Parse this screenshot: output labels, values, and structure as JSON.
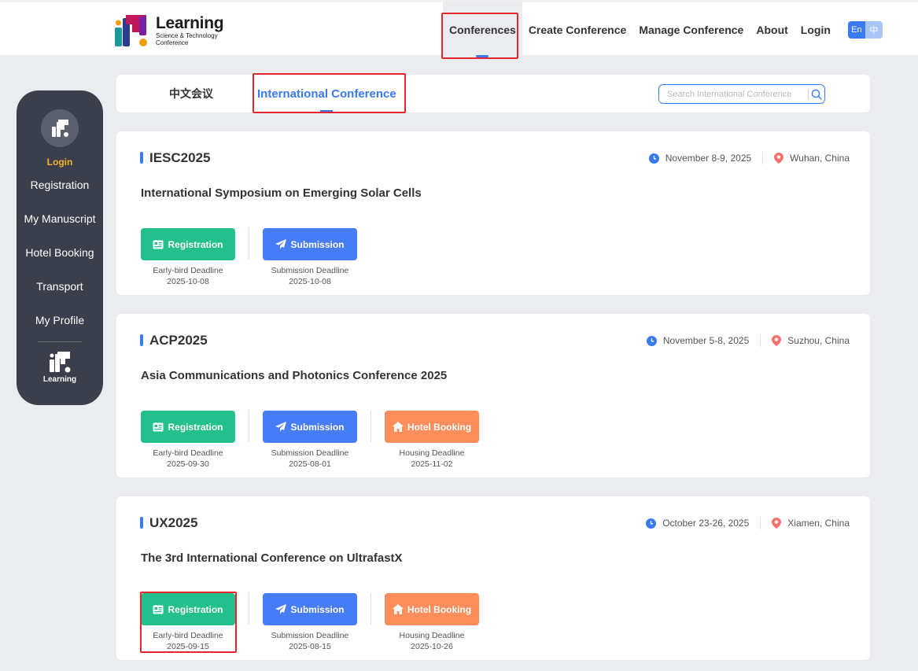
{
  "header": {
    "logo_title": "Learning",
    "logo_sub1": "Science & Technology",
    "logo_sub2": "Conference",
    "nav": [
      {
        "label": "Conferences"
      },
      {
        "label": "Create Conference"
      },
      {
        "label": "Manage Conference"
      },
      {
        "label": "About"
      },
      {
        "label": "Login"
      }
    ],
    "lang_en": "En",
    "lang_zh": "中"
  },
  "sidebar": {
    "login": "Login",
    "items": [
      {
        "label": "Registration"
      },
      {
        "label": "My Manuscript"
      },
      {
        "label": "Hotel Booking"
      },
      {
        "label": "Transport"
      },
      {
        "label": "My Profile"
      }
    ],
    "logo_text": "Learning"
  },
  "tabs": {
    "cn": "中文会议",
    "intl": "International Conference",
    "search_placeholder": "Search International Conference"
  },
  "conferences": [
    {
      "code": "IESC2025",
      "date": "November 8-9, 2025",
      "location": "Wuhan, China",
      "title": "International Symposium on Emerging Solar Cells",
      "actions": [
        {
          "label": "Registration",
          "deadline_label": "Early-bird Deadline",
          "deadline": "2025-10-08"
        },
        {
          "label": "Submission",
          "deadline_label": "Submission Deadline",
          "deadline": "2025-10-08"
        }
      ]
    },
    {
      "code": "ACP2025",
      "date": "November 5-8, 2025",
      "location": "Suzhou, China",
      "title": "Asia Communications and Photonics Conference 2025",
      "actions": [
        {
          "label": "Registration",
          "deadline_label": "Early-bird Deadline",
          "deadline": "2025-09-30"
        },
        {
          "label": "Submission",
          "deadline_label": "Submission Deadline",
          "deadline": "2025-08-01"
        },
        {
          "label": "Hotel Booking",
          "deadline_label": "Housing Deadline",
          "deadline": "2025-11-02"
        }
      ]
    },
    {
      "code": "UX2025",
      "date": "October 23-26, 2025",
      "location": "Xiamen, China",
      "title": "The 3rd International Conference on UltrafastX",
      "actions": [
        {
          "label": "Registration",
          "deadline_label": "Early-bird Deadline",
          "deadline": "2025-09-15"
        },
        {
          "label": "Submission",
          "deadline_label": "Submission Deadline",
          "deadline": "2025-08-15"
        },
        {
          "label": "Hotel Booking",
          "deadline_label": "Housing Deadline",
          "deadline": "2025-10-26"
        }
      ]
    }
  ],
  "colors": {
    "accent": "#3a7af2",
    "registration": "#23c08e",
    "submission": "#477cf8",
    "hotel": "#fd8d5b",
    "sidebar": "#3b3f4c",
    "highlight": "#e5262c"
  }
}
